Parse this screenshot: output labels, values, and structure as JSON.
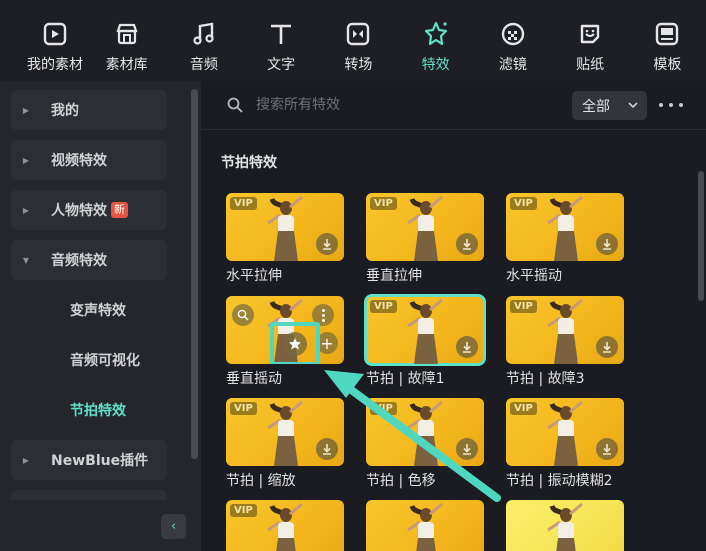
{
  "toolbar": {
    "items": [
      {
        "label": "我的素材",
        "icon": "my-assets-icon"
      },
      {
        "label": "素材库",
        "icon": "library-icon"
      },
      {
        "label": "音频",
        "icon": "music-note-icon"
      },
      {
        "label": "文字",
        "icon": "text-icon"
      },
      {
        "label": "转场",
        "icon": "transition-icon"
      },
      {
        "label": "特效",
        "icon": "effects-star-icon",
        "active": true
      },
      {
        "label": "滤镜",
        "icon": "filter-icon"
      },
      {
        "label": "贴纸",
        "icon": "sticker-icon"
      },
      {
        "label": "模板",
        "icon": "template-icon"
      }
    ]
  },
  "sidebar": {
    "items": [
      {
        "label": "我的",
        "arrow": "▶"
      },
      {
        "label": "视频特效",
        "arrow": "▶"
      },
      {
        "label": "人物特效",
        "arrow": "▶",
        "badge": "新"
      },
      {
        "label": "音频特效",
        "arrow": "▼"
      },
      {
        "label": "NewBlue插件",
        "arrow": "▶"
      }
    ],
    "subitems": [
      {
        "label": "变声特效"
      },
      {
        "label": "音频可视化"
      },
      {
        "label": "节拍特效",
        "active": true
      }
    ],
    "collapse_glyph": "‹"
  },
  "search": {
    "placeholder": "搜索所有特效",
    "filter_label": "全部"
  },
  "section": {
    "title": "节拍特效"
  },
  "effects": [
    {
      "name": "水平拉伸",
      "vip": "VIP"
    },
    {
      "name": "垂直拉伸",
      "vip": "VIP"
    },
    {
      "name": "水平摇动",
      "vip": "VIP"
    },
    {
      "name": "垂直摇动",
      "vip": "",
      "hovered": true
    },
    {
      "name": "节拍 | 故障1",
      "vip": "VIP",
      "selected": true
    },
    {
      "name": "节拍 | 故障3",
      "vip": "VIP"
    },
    {
      "name": "节拍 | 缩放",
      "vip": "VIP"
    },
    {
      "name": "节拍 | 色移",
      "vip": "VIP"
    },
    {
      "name": "节拍 | 振动模糊2",
      "vip": "VIP"
    },
    {
      "name": "",
      "vip": "VIP"
    },
    {
      "name": "",
      "vip": ""
    },
    {
      "name": "",
      "vip": ""
    }
  ],
  "colors": {
    "accent": "#5fe0c8",
    "annotation": "#4fd8bf",
    "badge_new": "#e8543f"
  }
}
